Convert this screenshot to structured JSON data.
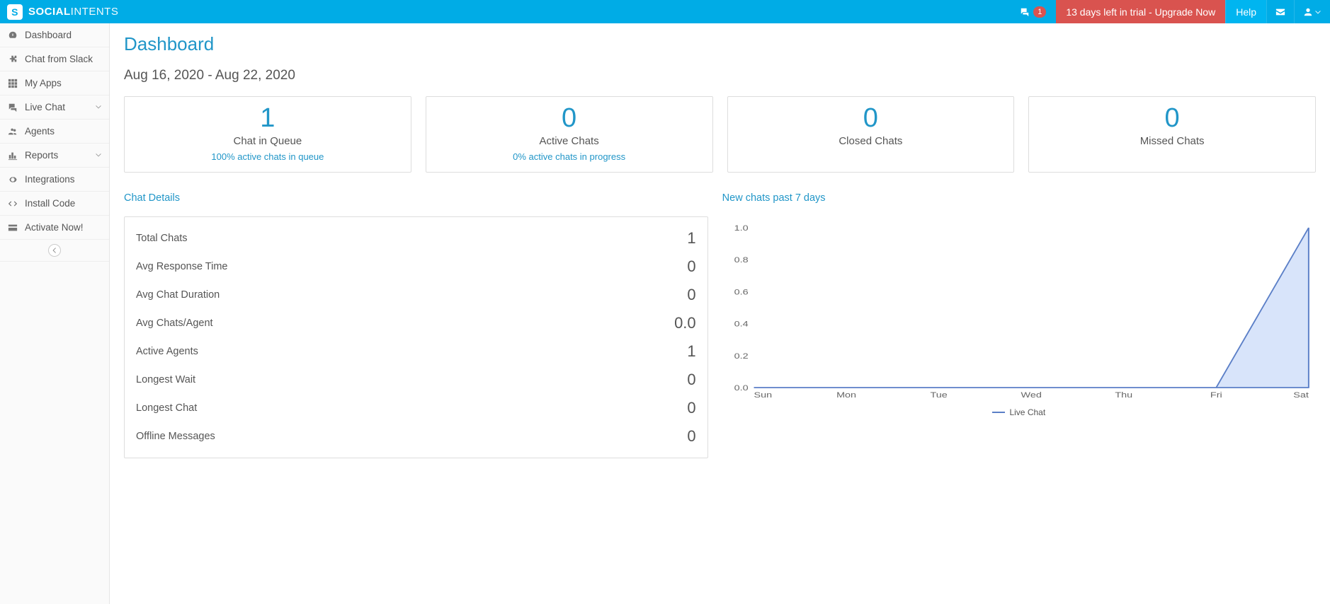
{
  "brand": {
    "strong": "SOCIAL",
    "light": "INTENTS"
  },
  "topbar": {
    "notif_count": "1",
    "trial_text": "13 days left in trial - Upgrade Now",
    "help": "Help"
  },
  "sidebar": {
    "items": [
      {
        "label": "Dashboard",
        "icon": "tachometer"
      },
      {
        "label": "Chat from Slack",
        "icon": "puzzle"
      },
      {
        "label": "My Apps",
        "icon": "th"
      },
      {
        "label": "Live Chat",
        "icon": "comments",
        "expandable": true
      },
      {
        "label": "Agents",
        "icon": "users"
      },
      {
        "label": "Reports",
        "icon": "bar-chart",
        "expandable": true
      },
      {
        "label": "Integrations",
        "icon": "cog"
      },
      {
        "label": "Install Code",
        "icon": "code"
      },
      {
        "label": "Activate Now!",
        "icon": "credit-card"
      }
    ]
  },
  "page": {
    "title": "Dashboard",
    "date_range": "Aug 16, 2020 - Aug 22, 2020"
  },
  "cards": [
    {
      "value": "1",
      "label": "Chat in Queue",
      "sub": "100% active chats in queue"
    },
    {
      "value": "0",
      "label": "Active Chats",
      "sub": "0% active chats in progress"
    },
    {
      "value": "0",
      "label": "Closed Chats"
    },
    {
      "value": "0",
      "label": "Missed Chats"
    }
  ],
  "chat_details": {
    "title": "Chat Details",
    "rows": [
      {
        "label": "Total Chats",
        "value": "1"
      },
      {
        "label": "Avg Response Time",
        "value": "0"
      },
      {
        "label": "Avg Chat Duration",
        "value": "0"
      },
      {
        "label": "Avg Chats/Agent",
        "value": "0.0"
      },
      {
        "label": "Active Agents",
        "value": "1"
      },
      {
        "label": "Longest Wait",
        "value": "0"
      },
      {
        "label": "Longest Chat",
        "value": "0"
      },
      {
        "label": "Offline Messages",
        "value": "0"
      }
    ]
  },
  "chart_section_title": "New chats past 7 days",
  "chart_data": {
    "type": "area",
    "categories": [
      "Sun",
      "Mon",
      "Tue",
      "Wed",
      "Thu",
      "Fri",
      "Sat"
    ],
    "series": [
      {
        "name": "Live Chat",
        "values": [
          0,
          0,
          0,
          0,
          0,
          0,
          1
        ]
      }
    ],
    "ylabel": "",
    "xlabel": "",
    "ylim": [
      0,
      1.0
    ],
    "yticks": [
      0.0,
      0.2,
      0.4,
      0.6,
      0.8,
      1.0
    ]
  }
}
